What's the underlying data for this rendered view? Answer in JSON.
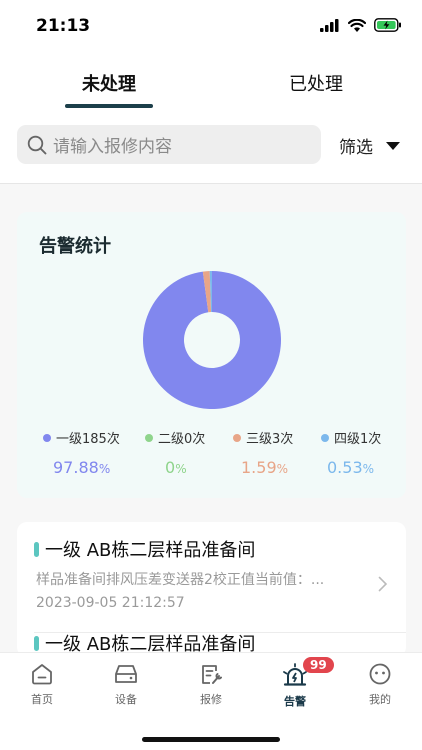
{
  "status_bar": {
    "time": "21:13"
  },
  "tabs": [
    {
      "label": "未处理",
      "active": true
    },
    {
      "label": "已处理",
      "active": false
    }
  ],
  "search": {
    "placeholder": "请输入报修内容"
  },
  "filter": {
    "label": "筛选"
  },
  "stats": {
    "title": "告警统计",
    "colors": {
      "level1": "#8187ee",
      "level2": "#8fd48c",
      "level3": "#e8a588",
      "level4": "#7cb8ec"
    },
    "legend": [
      {
        "label": "一级185次",
        "percent": "97.88",
        "unit": "%"
      },
      {
        "label": "二级0次",
        "percent": "0",
        "unit": "%"
      },
      {
        "label": "三级3次",
        "percent": "1.59",
        "unit": "%"
      },
      {
        "label": "四级1次",
        "percent": "0.53",
        "unit": "%"
      }
    ]
  },
  "chart_data": {
    "type": "pie",
    "categories": [
      "一级",
      "二级",
      "三级",
      "四级"
    ],
    "values": [
      185,
      0,
      3,
      1
    ],
    "title": "告警统计"
  },
  "alarms": [
    {
      "title": "一级 AB栋二层样品准备间",
      "description": "样品准备间排风压差变送器2校正值当前值：...",
      "time": "2023-09-05 21:12:57"
    },
    {
      "title": "一级 AB栋二层样品准备间",
      "description": "",
      "time": ""
    }
  ],
  "bottom_nav": {
    "items": [
      {
        "label": "首页",
        "icon": "home-icon"
      },
      {
        "label": "设备",
        "icon": "device-icon"
      },
      {
        "label": "报修",
        "icon": "repair-icon"
      },
      {
        "label": "告警",
        "icon": "alarm-icon",
        "active": true,
        "badge": "99"
      },
      {
        "label": "我的",
        "icon": "profile-icon"
      }
    ]
  }
}
